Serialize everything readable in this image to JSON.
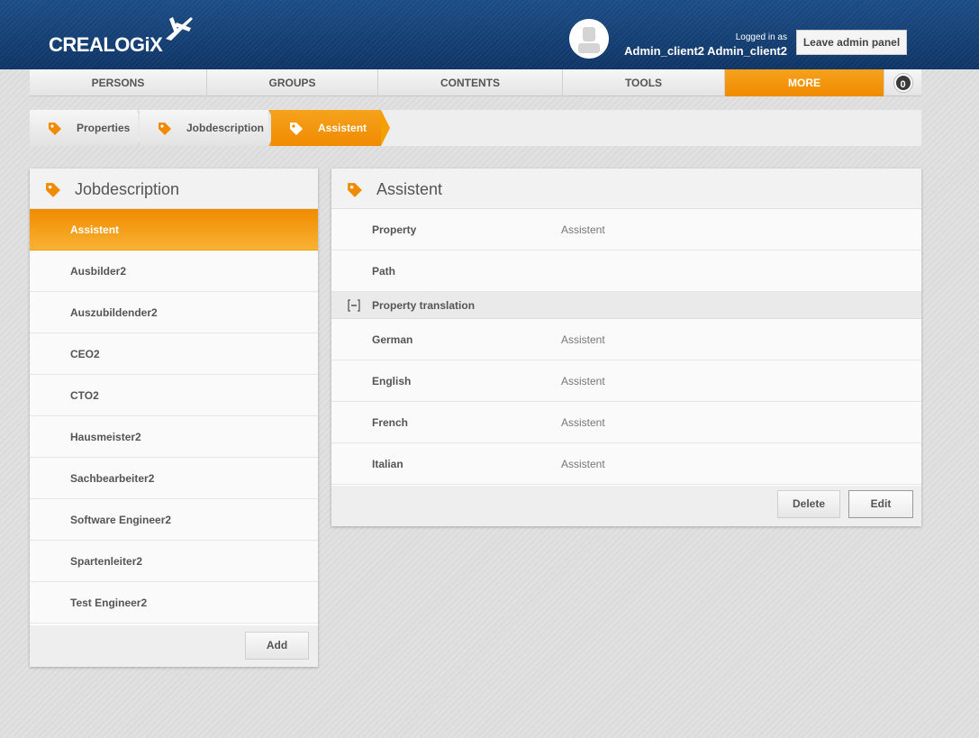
{
  "header": {
    "logo_text": "CREALOGiX",
    "logo_icon": "plane-icon",
    "logged_in_label": "Logged in as",
    "user_name": "Admin_client2 Admin_client2",
    "leave_button": "Leave admin panel",
    "accent_color": "#f08b00",
    "brand_color": "#113a6d"
  },
  "nav": {
    "items": [
      {
        "label": "PERSONS"
      },
      {
        "label": "GROUPS"
      },
      {
        "label": "CONTENTS"
      },
      {
        "label": "TOOLS"
      },
      {
        "label": "MORE"
      }
    ],
    "badge": "0"
  },
  "breadcrumb": {
    "items": [
      {
        "label": "Properties",
        "icon": "tag-icon"
      },
      {
        "label": "Jobdescription",
        "icon": "tag-icon"
      },
      {
        "label": "Assistent",
        "icon": "tag-icon"
      }
    ]
  },
  "left_panel": {
    "title": "Jobdescription",
    "items": [
      {
        "label": "Assistent"
      },
      {
        "label": "Ausbilder2"
      },
      {
        "label": "Auszubildender2"
      },
      {
        "label": "CEO2"
      },
      {
        "label": "CTO2"
      },
      {
        "label": "Hausmeister2"
      },
      {
        "label": "Sachbearbeiter2"
      },
      {
        "label": "Software Engineer2"
      },
      {
        "label": "Spartenleiter2"
      },
      {
        "label": "Test Engineer2"
      }
    ],
    "add_button": "Add"
  },
  "right_panel": {
    "title": "Assistent",
    "property_label": "Property",
    "property_value": "Assistent",
    "path_label": "Path",
    "path_value": "",
    "translation_section": "Property translation",
    "translations": [
      {
        "label": "German",
        "value": "Assistent"
      },
      {
        "label": "English",
        "value": "Assistent"
      },
      {
        "label": "French",
        "value": "Assistent"
      },
      {
        "label": "Italian",
        "value": "Assistent"
      }
    ],
    "delete_button": "Delete",
    "edit_button": "Edit"
  }
}
